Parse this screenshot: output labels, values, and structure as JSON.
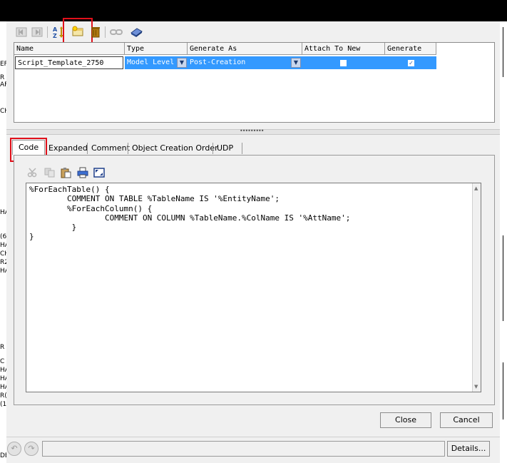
{
  "toolbar": {
    "icons": [
      "nav-back-icon",
      "nav-forward-icon",
      "sort-az-icon",
      "new-template-icon",
      "delete-icon",
      "link-icon",
      "book-icon"
    ]
  },
  "grid": {
    "columns": [
      "Name",
      "Type",
      "Generate As",
      "Attach To New",
      "Generate"
    ],
    "row": {
      "name": "Script_Template_2750",
      "type": "Model Level",
      "generate_as": "Post-Creation",
      "attach_to_new": false,
      "generate": true
    }
  },
  "splitter_grip": "•••••••••",
  "tabs": [
    "Code",
    "Expanded",
    "Comment",
    "Object Creation Order",
    "UDP"
  ],
  "active_tab": "Code",
  "editor": {
    "tools": [
      "cut-icon",
      "copy-icon",
      "paste-icon",
      "print-icon",
      "fullscreen-icon"
    ],
    "code": "%ForEachTable() {\n        COMMENT ON TABLE %TableName IS '%EntityName';\n        %ForEachColumn() {\n                COMMENT ON COLUMN %TableName.%ColName IS '%AttName';\n         }\n}"
  },
  "buttons": {
    "close": "Close",
    "cancel": "Cancel",
    "details": "Details..."
  },
  "status": {
    "text": ""
  },
  "background_fragments": [
    "EF",
    "R",
    "AF",
    "CH",
    "",
    "HA",
    "(6",
    "HA",
    "CH",
    "R2",
    "HA",
    "",
    "R",
    "C",
    "HA",
    "HA",
    "HA",
    "R(",
    "(1",
    "DE"
  ],
  "colors": {
    "selection": "#3399ff",
    "highlight_box": "#e0101a",
    "panel_bg": "#f0f0f0"
  }
}
